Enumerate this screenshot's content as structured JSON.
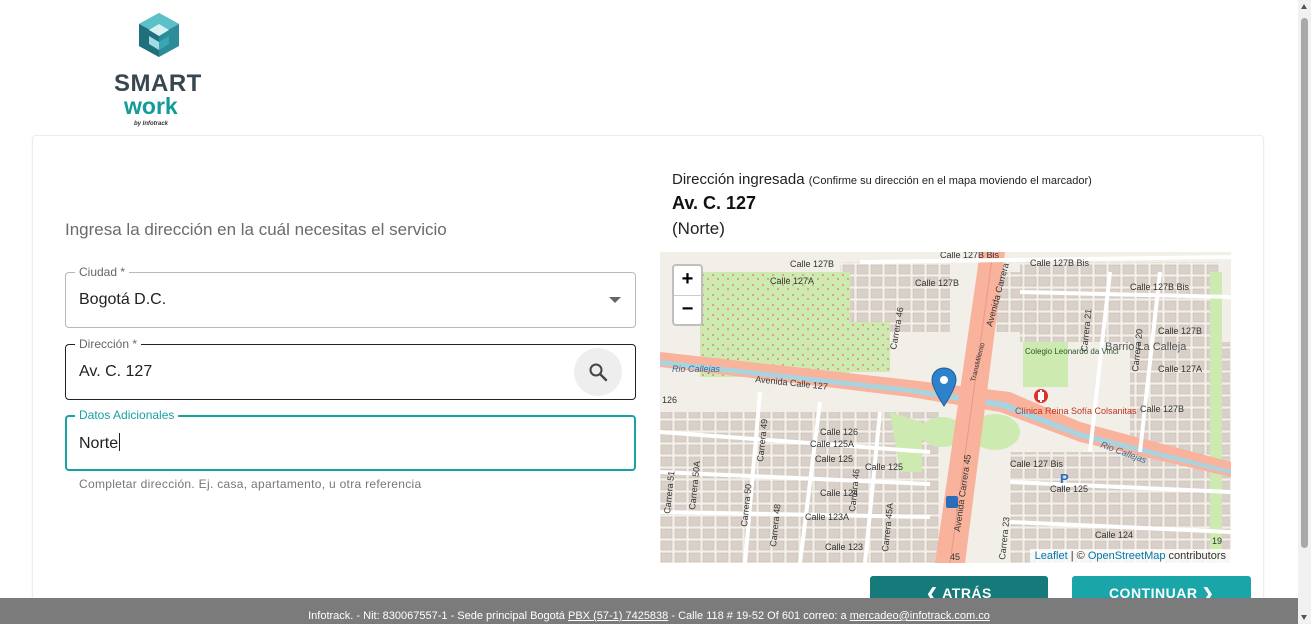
{
  "brand": {
    "name_line1": "SMART",
    "name_line2": "work",
    "byline": "by Infotrack",
    "primary_color": "#17a2a3",
    "dark_color": "#37474f"
  },
  "form": {
    "title": "Ingresa la dirección en la cuál necesitas el servicio",
    "city": {
      "label": "Ciudad *",
      "value": "Bogotá D.C."
    },
    "address": {
      "label": "Dirección *",
      "value": "Av. C. 127"
    },
    "extra": {
      "label": "Datos Adicionales",
      "value": "Norte",
      "helper": "Completar dirección. Ej. casa, apartamento, u otra referencia"
    }
  },
  "entered": {
    "heading": "Dirección ingresada",
    "note": "(Confirme su dirección en el mapa moviendo el marcador)",
    "address": "Av. C. 127",
    "extra": "(Norte)"
  },
  "map": {
    "zoom_in": "+",
    "zoom_out": "−",
    "attribution_leaflet": "Leaflet",
    "attribution_sep": " | © ",
    "attribution_osm": "OpenStreetMap",
    "attribution_tail": " contributors",
    "labels": {
      "calle127b_a": "Calle 127B",
      "calle127b_bis_top": "Calle 127B Bis",
      "calle127a": "Calle 127A",
      "calle127b_mid": "Calle 127B",
      "calle127b_bis_r": "Calle 127B Bis",
      "calle127b_r": "Calle 127B",
      "calle127a_r": "Calle 127A",
      "calle127_bis": "Calle 127 Bis",
      "avenida_calle127": "Avenida Calle 127",
      "rio_callejas_l": "Rio Callejas",
      "rio_callejas_r": "Rio Callejas",
      "avenida_carrera45": "Avenida Carrera 45",
      "avenida_carrera_top": "Avenida Carrera",
      "transmilenio": "TransMilenio",
      "carrera46": "Carrera 46",
      "colegio": "Colegio Leonardo da Vinci",
      "barrio": "Barrio La Calleja",
      "clinica": "Clínica Reina Sofía Colsanitas",
      "calle126": "Calle 126",
      "calle125a": "Calle 125A",
      "calle125": "Calle 125",
      "calle125_b": "Calle 125",
      "calle125_bis": "Calle 125 Bis",
      "calle125_r": "Calle 125",
      "calle124": "Calle 124",
      "calle124_r": "Calle 124",
      "calle123a": "Calle 123A",
      "calle123": "Calle 123",
      "carrera49": "Carrera 49",
      "carrera51": "Carrera 51",
      "carrera50a": "Carrera 50A",
      "carrera50": "Carrera 50",
      "carrera48": "Carrera 48",
      "carrera46_b": "Carrera 46",
      "carrera45a": "Carrera 45A",
      "carrera21": "Carrera 21",
      "carrera20": "Carrera 20",
      "carrera23": "Carrera 23",
      "n126": "126",
      "n45": "45",
      "n19": "19"
    }
  },
  "buttons": {
    "back": "ATRÁS",
    "next": "CONTINUAR"
  },
  "footer": {
    "company": "Infotrack. - Nit: 830067557-1 - Sede principal Bogotá",
    "phone": "PBX (57-1) 7425838",
    "address": " - Calle 118 # 19-52 Of 601   correo: a ",
    "email": "mercadeo@infotrack.com.co"
  }
}
